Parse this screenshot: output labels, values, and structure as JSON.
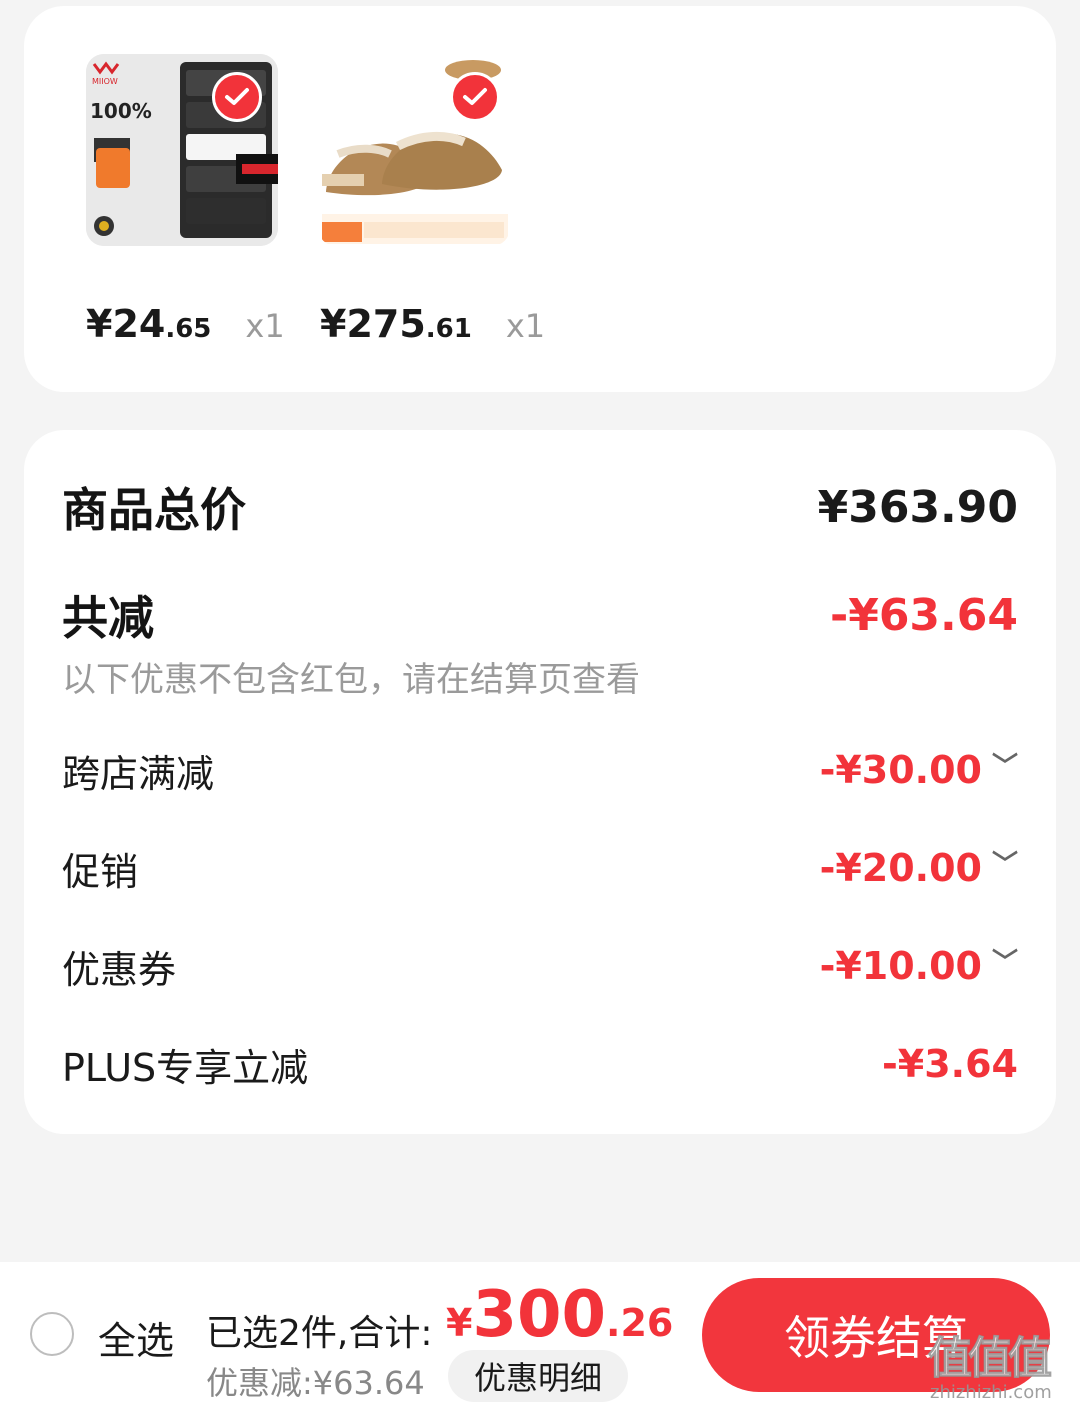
{
  "products": [
    {
      "price_int": "¥24",
      "price_dec": ".65",
      "qty": "x1"
    },
    {
      "price_int": "¥275",
      "price_dec": ".61",
      "qty": "x1"
    }
  ],
  "summary": {
    "total_label": "商品总价",
    "total_value": "¥363.90",
    "reduction_label": "共减",
    "reduction_value": "-¥63.64",
    "note": "以下优惠不包含红包，请在结算页查看",
    "items": [
      {
        "label": "跨店满减",
        "value": "-¥30.00"
      },
      {
        "label": "促销",
        "value": "-¥20.00"
      },
      {
        "label": "优惠券",
        "value": "-¥10.00"
      },
      {
        "label": "PLUS专享立减",
        "value": "-¥3.64"
      }
    ]
  },
  "bottom_bar": {
    "select_all": "全选",
    "selected_prefix": "已选2件,合计:",
    "total_currency": "¥",
    "total_int": "300",
    "total_dec": ".26",
    "discount": "优惠减:¥63.64",
    "detail": "优惠明细",
    "checkout": "领券结算"
  },
  "watermark": {
    "logo": "值值值",
    "url": "zhizhizhi.com"
  },
  "colors": {
    "accent": "#f2333a",
    "background": "#f4f4f4"
  },
  "icons": [
    "check-icon",
    "chevron-down-icon",
    "radio-icon"
  ]
}
